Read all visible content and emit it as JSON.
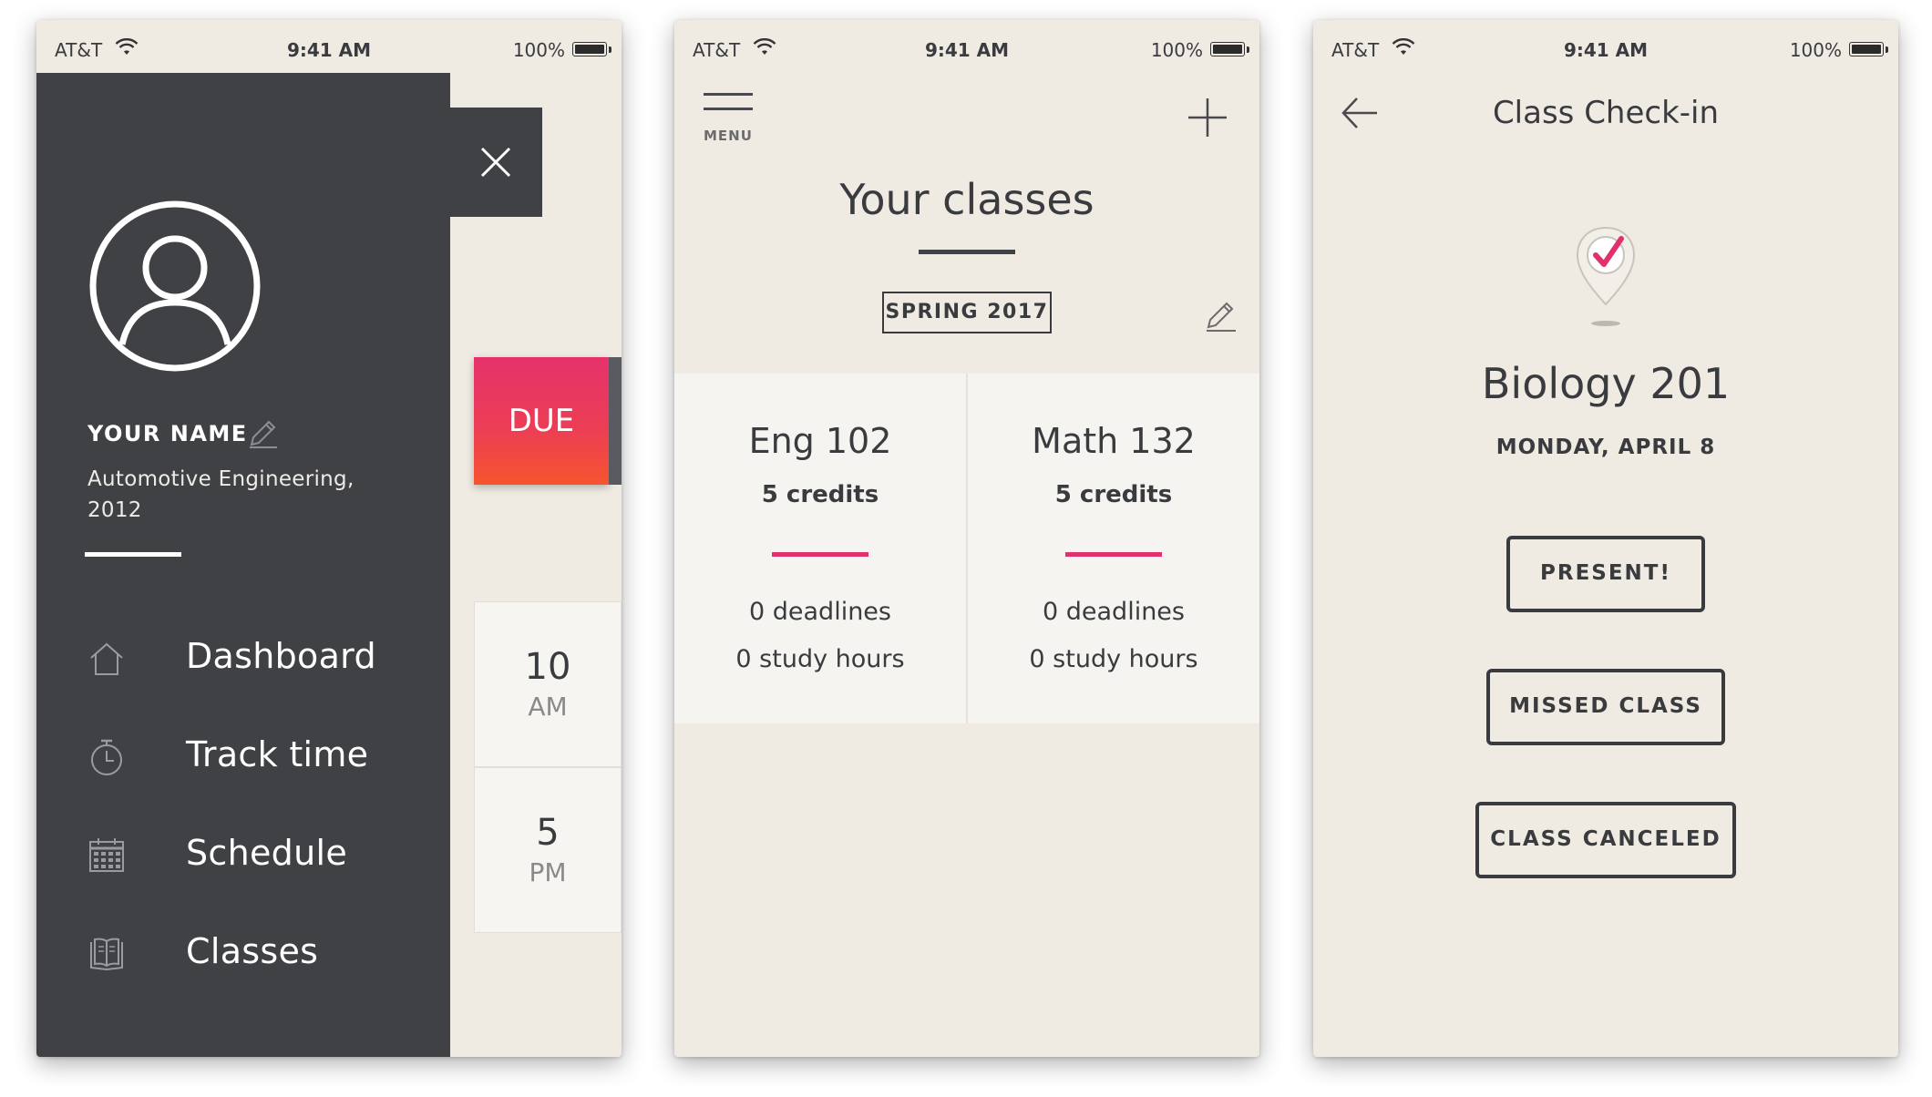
{
  "status_bar": {
    "carrier": "AT&T",
    "time": "9:41 AM",
    "battery": "100%"
  },
  "screen1": {
    "profile": {
      "name": "YOUR NAME",
      "major": "Automotive Engineering, 2012"
    },
    "menu": [
      {
        "label": "Dashboard",
        "icon": "home-icon"
      },
      {
        "label": "Track time",
        "icon": "stopwatch-icon"
      },
      {
        "label": "Schedule",
        "icon": "calendar-icon"
      },
      {
        "label": "Classes",
        "icon": "book-icon"
      }
    ],
    "due_label": "DUE",
    "times": [
      {
        "value": "10",
        "unit": "AM"
      },
      {
        "value": "5",
        "unit": "PM"
      }
    ]
  },
  "screen2": {
    "menu_label": "MENU",
    "title": "Your classes",
    "semester": "SPRING 2017",
    "classes": [
      {
        "name": "Eng 102",
        "credits": "5 credits",
        "deadlines": "0 deadlines",
        "hours": "0 study hours"
      },
      {
        "name": "Math 132",
        "credits": "5 credits",
        "deadlines": "0 deadlines",
        "hours": "0 study hours"
      }
    ],
    "accent": "#e0306d"
  },
  "screen3": {
    "title": "Class Check-in",
    "class_name": "Biology 201",
    "date": "MONDAY, APRIL 8",
    "buttons": {
      "present": "PRESENT!",
      "missed": "MISSED CLASS",
      "canceled": "CLASS CANCELED"
    }
  },
  "colors": {
    "drawer": "#404145",
    "background": "#efebe3",
    "accent": "#e0306d",
    "due_gradient_start": "#e6326c",
    "due_gradient_end": "#f6552f"
  }
}
